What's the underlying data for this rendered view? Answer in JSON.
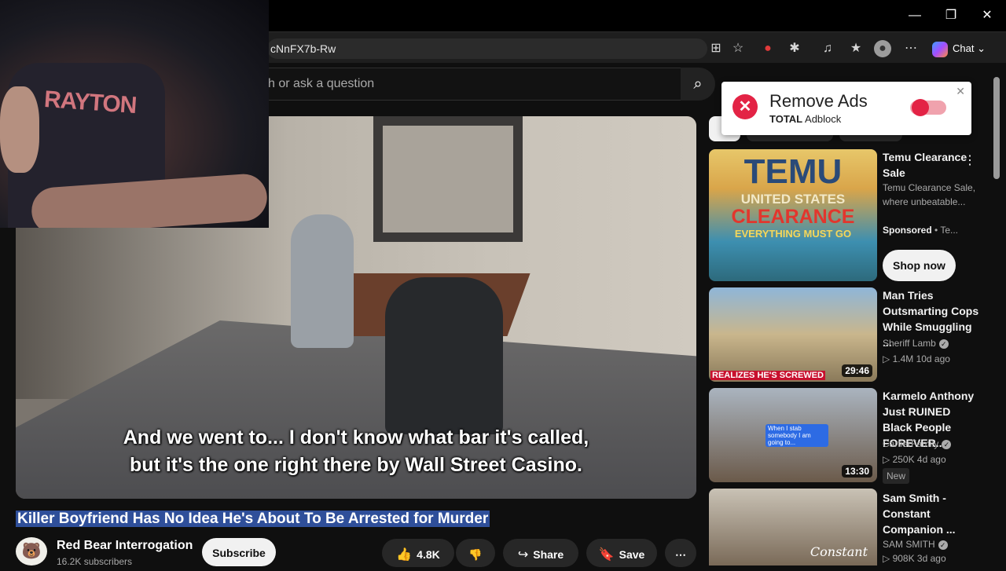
{
  "browser": {
    "url_fragment": "cNnFX7b-Rw",
    "chat_label": "Chat",
    "window_controls": {
      "minimize": "—",
      "restore": "❐",
      "close": "✕"
    }
  },
  "youtube": {
    "search_placeholder": "h or ask a question"
  },
  "webcam": {
    "shirt_text": "RAYTON"
  },
  "video": {
    "subtitle_line1": "And we went to... I don't know what bar it's called,",
    "subtitle_line2": "but it's the one right there by Wall Street Casino.",
    "title": "Killer Boyfriend Has No Idea He's About To Be Arrested for Murder",
    "channel_name": "Red Bear Interrogation",
    "channel_subs": "16.2K subscribers",
    "subscribe_label": "Subscribe",
    "like_count": "4.8K",
    "share_label": "Share",
    "save_label": "Save",
    "more_label": "⋯"
  },
  "popup": {
    "title": "Remove Ads",
    "brand_bold": "TOTAL",
    "brand_rest": " Adblock",
    "close": "✕"
  },
  "recommendations": [
    {
      "title": "Temu Clearance Sale",
      "line1": "Temu Clearance Sale, where unbeatable...",
      "sponsored": "Sponsored",
      "sponsor_rest": " • Te...",
      "cta": "Shop now",
      "thumb_lines": [
        "TEMU",
        "UNITED STATES",
        "CLEARANCE",
        "EVERYTHING MUST GO"
      ]
    },
    {
      "title": "Man Tries Outsmarting Cops While Smuggling ...",
      "channel": "Sheriff Lamb",
      "meta": "▷ 1.4M  10d ago",
      "duration": "29:46",
      "thumb_text": "REALIZES HE'S SCREWED"
    },
    {
      "title": "Karmelo Anthony Just RUINED Black People FOREVER...",
      "channel": "CartierFamily",
      "meta": "▷ 250K  4d ago",
      "badge": "New",
      "duration": "13:30",
      "thumb_text": "When I stab somebody I am going to..."
    },
    {
      "title": "Sam Smith - Constant Companion ...",
      "channel": "SAM SMITH",
      "meta": "▷ 908K  3d ago",
      "thumb_text": "Constant"
    }
  ],
  "colors": {
    "background": "#0f0f0f",
    "popup_red": "#e32345",
    "title_highlight": "#2f4f9a"
  }
}
